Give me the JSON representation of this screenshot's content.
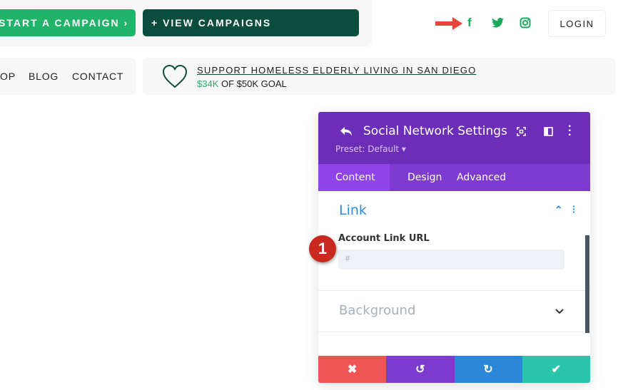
{
  "header": {
    "start_campaign": "START A CAMPAIGN ›",
    "view_campaigns": "+ VIEW CAMPAIGNS",
    "login": "LOGIN",
    "social": [
      {
        "icon": "facebook-icon",
        "glyph": "f"
      },
      {
        "icon": "twitter-icon",
        "glyph": "🐦"
      },
      {
        "icon": "instagram-icon",
        "glyph": "◎"
      }
    ]
  },
  "nav": {
    "items": [
      "OP",
      "BLOG",
      "CONTACT"
    ]
  },
  "campaign": {
    "title": "SUPPORT HOMELESS ELDERLY LIVING IN SAN DIEGO",
    "raised": "$34K",
    "goal": "OF $50K GOAL"
  },
  "panel": {
    "title": "Social Network Settings",
    "preset": "Preset: Default ▾",
    "tabs": [
      "Content",
      "Design",
      "Advanced"
    ],
    "section_link": "Link",
    "field_label": "Account Link URL",
    "field_placeholder": "#",
    "section_background": "Background",
    "badge": "1"
  },
  "colors": {
    "green": "#22b36b",
    "dark_green": "#0a4d3c",
    "purple": "#6c2eb9",
    "cancel": "#ef5555",
    "undo": "#7d3bcf",
    "redo": "#2b87da",
    "save": "#29c4a9"
  }
}
